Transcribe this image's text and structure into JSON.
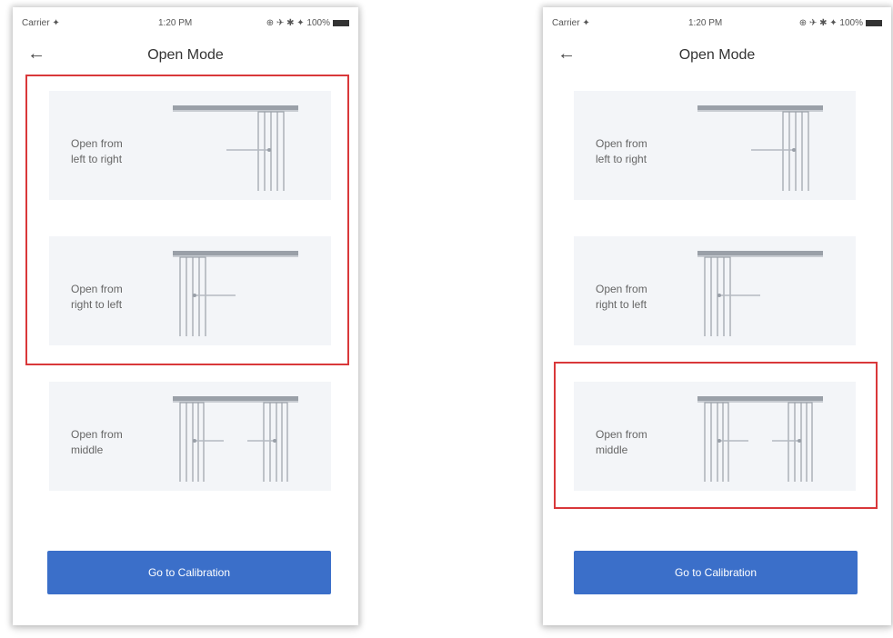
{
  "status_bar": {
    "carrier": "Carrier ✦",
    "time": "1:20 PM",
    "indicators": "⊕ ✈ ✱ ✦ 100%"
  },
  "nav": {
    "back_icon": "←",
    "title": "Open Mode"
  },
  "options": [
    {
      "label": "Open from\nleft to right",
      "icon": "curtain-left-to-right-icon"
    },
    {
      "label": "Open from\nright to left",
      "icon": "curtain-right-to-left-icon"
    },
    {
      "label": "Open from\nmiddle",
      "icon": "curtain-middle-icon"
    }
  ],
  "button": {
    "label": "Go to Calibration"
  },
  "colors": {
    "highlight": "#d9383a",
    "primary": "#3b6fc9",
    "card": "#f3f5f8"
  }
}
